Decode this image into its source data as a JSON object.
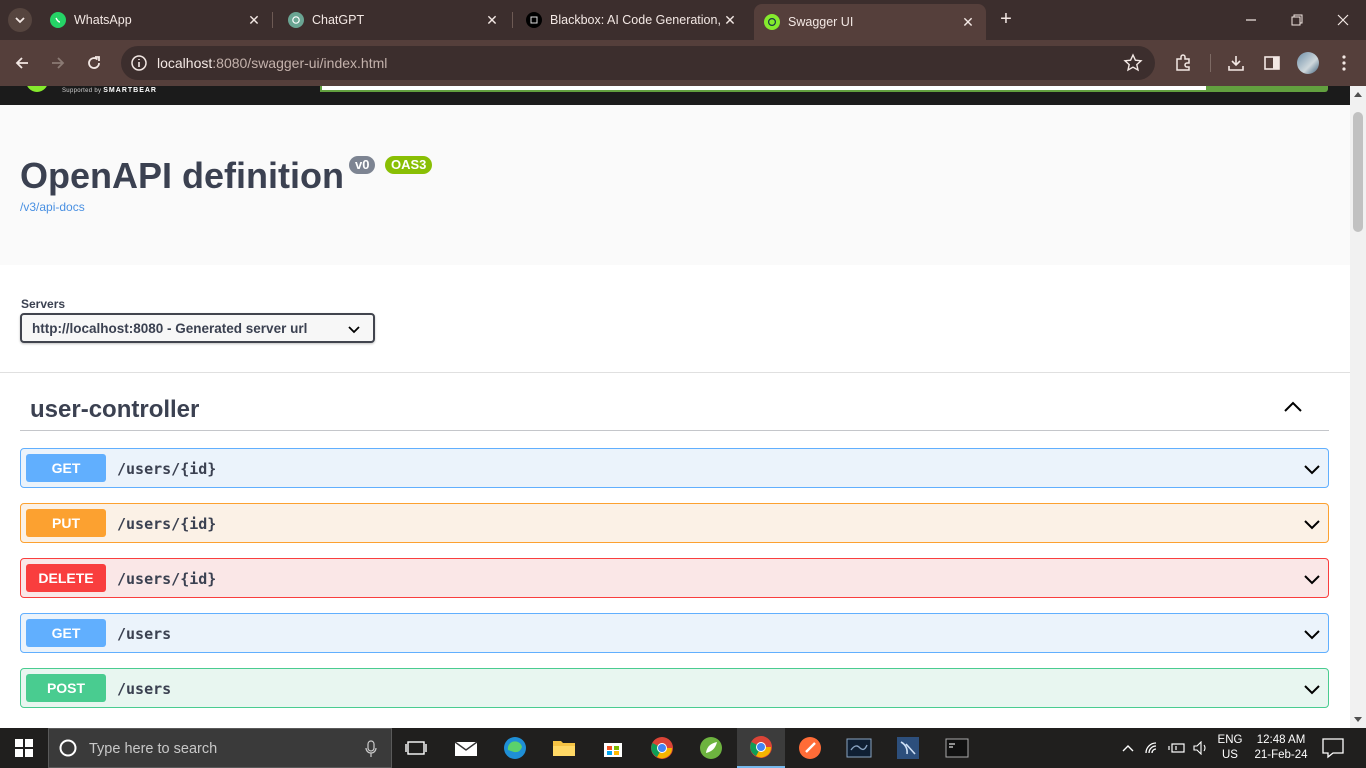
{
  "browser": {
    "tabs": [
      {
        "title": "WhatsApp",
        "icon": "whatsapp-icon",
        "active": false
      },
      {
        "title": "ChatGPT",
        "icon": "chatgpt-icon",
        "active": false
      },
      {
        "title": "Blackbox: AI Code Generation, C",
        "icon": "blackbox-icon",
        "active": false
      },
      {
        "title": "Swagger UI",
        "icon": "swagger-icon",
        "active": true
      }
    ],
    "url_host": "localhost",
    "url_path": ":8080/swagger-ui/index.html"
  },
  "swagger": {
    "supported_by": "Supported by",
    "smartbear": "SMARTBEAR",
    "title": "OpenAPI definition",
    "version_badge": "v0",
    "oas_badge": "OAS3",
    "spec_link": "/v3/api-docs",
    "servers_label": "Servers",
    "server_selected": "http://localhost:8080 - Generated server url",
    "tag": "user-controller",
    "operations": [
      {
        "method": "GET",
        "path": "/users/{id}"
      },
      {
        "method": "PUT",
        "path": "/users/{id}"
      },
      {
        "method": "DELETE",
        "path": "/users/{id}"
      },
      {
        "method": "GET",
        "path": "/users"
      },
      {
        "method": "POST",
        "path": "/users"
      }
    ]
  },
  "taskbar": {
    "search_placeholder": "Type here to search",
    "lang_top": "ENG",
    "lang_bottom": "US",
    "time": "12:48 AM",
    "date": "21-Feb-24"
  },
  "colors": {
    "get": "#61affe",
    "put": "#fca130",
    "delete": "#f93e3e",
    "post": "#49cc90",
    "oas3": "#89bf04",
    "browser_frame": "#3c2e2d"
  }
}
